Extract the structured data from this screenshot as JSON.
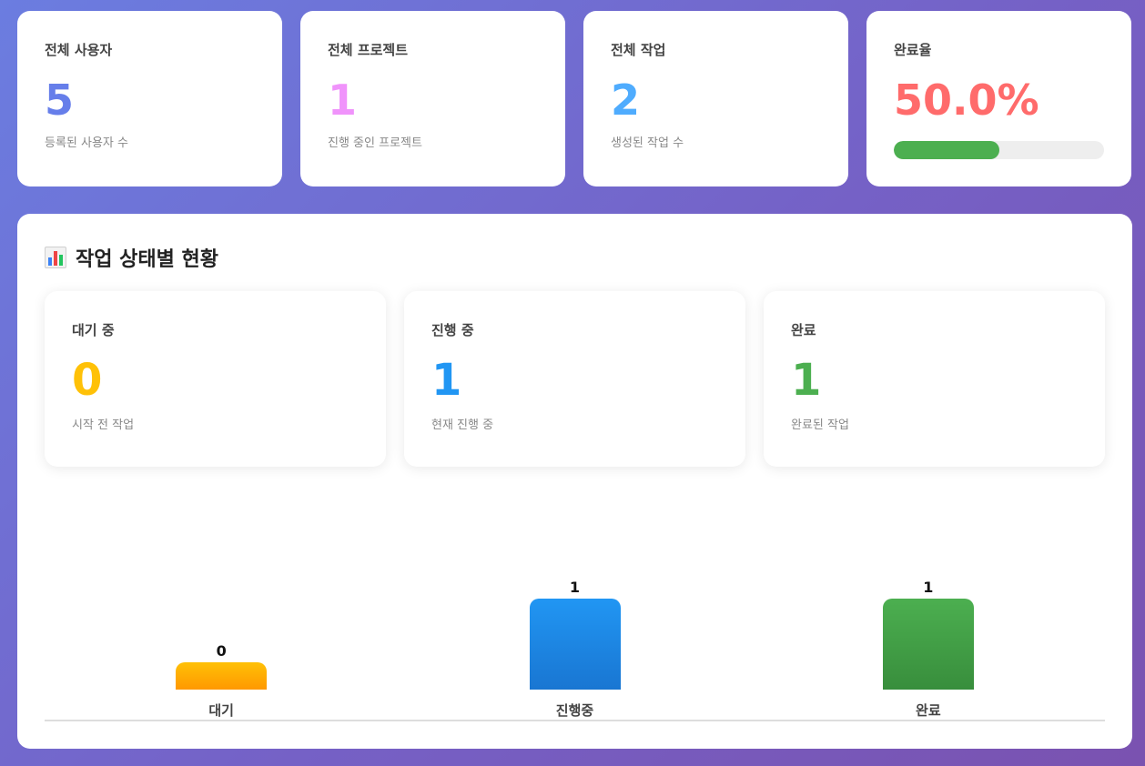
{
  "stats": [
    {
      "label": "전체 사용자",
      "value": "5",
      "desc": "등록된 사용자 수",
      "color": "#667eea"
    },
    {
      "label": "전체 프로젝트",
      "value": "1",
      "desc": "진행 중인 프로젝트",
      "color": "#f093fb"
    },
    {
      "label": "전체 작업",
      "value": "2",
      "desc": "생성된 작업 수",
      "color": "#4facfe"
    },
    {
      "label": "완료율",
      "value": "50.0%",
      "progress": 0.5,
      "color": "#ff6b6b",
      "progress_color": "#4caf50"
    }
  ],
  "panel": {
    "title": "작업 상태별 현황",
    "icon": "bar-chart-icon",
    "status_cards": [
      {
        "label": "대기 중",
        "value": "0",
        "desc": "시작 전 작업",
        "color": "#ffc107"
      },
      {
        "label": "진행 중",
        "value": "1",
        "desc": "현재 진행 중",
        "color": "#2196f3"
      },
      {
        "label": "완료",
        "value": "1",
        "desc": "완료된 작업",
        "color": "#4caf50"
      }
    ]
  },
  "chart_data": {
    "type": "bar",
    "categories": [
      "대기",
      "진행중",
      "완료"
    ],
    "values": [
      0,
      1,
      1
    ],
    "colors": [
      [
        "#ffc107",
        "#ff9800"
      ],
      [
        "#2196f3",
        "#1976d2"
      ],
      [
        "#4caf50",
        "#388e3c"
      ]
    ]
  }
}
